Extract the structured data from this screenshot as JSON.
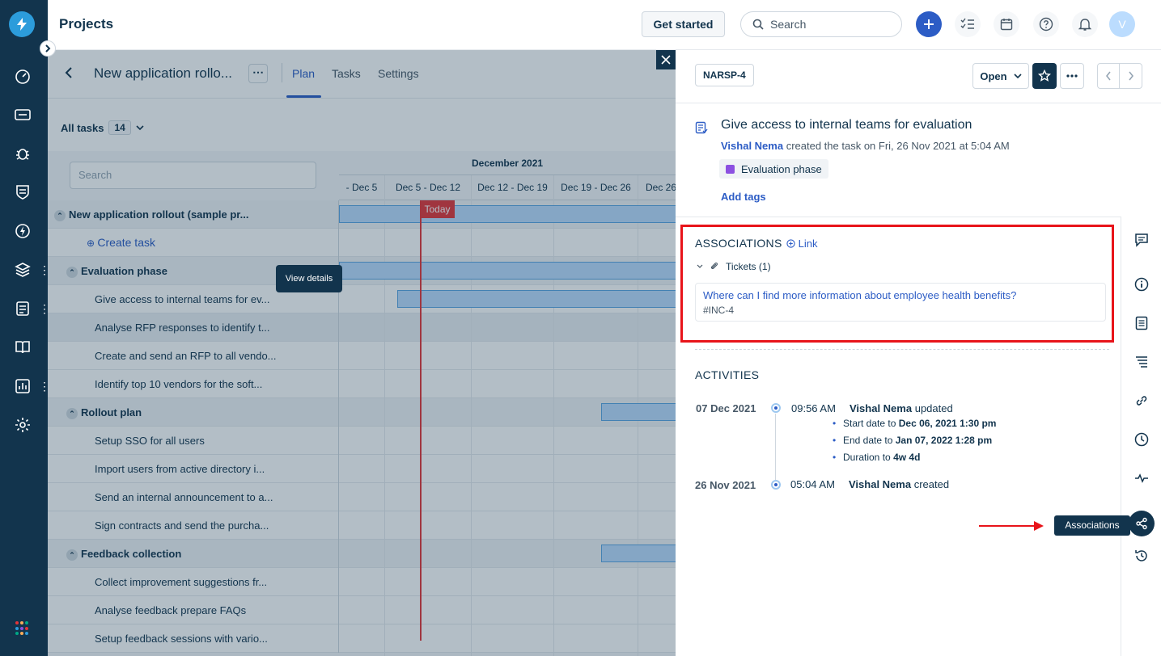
{
  "header": {
    "title": "Projects",
    "get_started": "Get started",
    "search_placeholder": "Search",
    "avatar_initial": "V"
  },
  "project": {
    "title": "New application rollo...",
    "more": "⋯",
    "tabs": [
      "Plan",
      "Tasks",
      "Settings"
    ],
    "all_tasks_label": "All tasks",
    "all_tasks_count": "14",
    "task_search_placeholder": "Search"
  },
  "gantt": {
    "month": "December 2021",
    "weeks": [
      "- Dec 5",
      "Dec 5 - Dec 12",
      "Dec 12 - Dec 19",
      "Dec 19 - Dec 26",
      "Dec 26"
    ],
    "today_label": "Today",
    "view_details": "View details",
    "rows": [
      {
        "label": "New application rollout (sample pr...",
        "type": "group"
      },
      {
        "label": "Create task",
        "type": "create"
      },
      {
        "label": "Evaluation phase",
        "type": "group"
      },
      {
        "label": "Give access to internal teams for ev...",
        "type": "task"
      },
      {
        "label": "Analyse RFP responses to identify t...",
        "type": "task"
      },
      {
        "label": "Create and send an RFP to all vendo...",
        "type": "task"
      },
      {
        "label": "Identify top 10 vendors for the soft...",
        "type": "task"
      },
      {
        "label": "Rollout plan",
        "type": "group"
      },
      {
        "label": "Setup SSO for all users",
        "type": "task"
      },
      {
        "label": "Import users from active directory i...",
        "type": "task"
      },
      {
        "label": "Send an internal announcement to a...",
        "type": "task"
      },
      {
        "label": "Sign contracts and send the purcha...",
        "type": "task"
      },
      {
        "label": "Feedback collection",
        "type": "group"
      },
      {
        "label": "Collect improvement suggestions fr...",
        "type": "task"
      },
      {
        "label": "Analyse feedback prepare FAQs",
        "type": "task"
      },
      {
        "label": "Setup feedback sessions with vario...",
        "type": "task"
      }
    ]
  },
  "panel": {
    "task_id": "NARSP-4",
    "status": "Open",
    "task_title": "Give access to internal teams for evaluation",
    "creator_name": "Vishal Nema",
    "created_text": " created the task on Fri, 26 Nov 2021 at 5:04 AM",
    "phase": "Evaluation phase",
    "add_tags": "Add tags",
    "associations_title": "ASSOCIATIONS",
    "link_label": "Link",
    "tickets_label": "Tickets (1)",
    "ticket_title": "Where can I find more information about employee health benefits?",
    "ticket_id": "#INC-4",
    "activities_title": "ACTIVITIES",
    "activities": [
      {
        "date": "07 Dec 2021",
        "time": "09:56 AM",
        "user": "Vishal Nema",
        "action": "updated",
        "changes": [
          {
            "field": "Start date",
            "to": "to",
            "value": "Dec 06, 2021 1:30 pm"
          },
          {
            "field": "End date",
            "to": "to",
            "value": "Jan 07, 2022 1:28 pm"
          },
          {
            "field": "Duration",
            "to": "to",
            "value": "4w 4d"
          }
        ]
      },
      {
        "date": "26 Nov 2021",
        "time": "05:04 AM",
        "user": "Vishal Nema",
        "action": "created"
      }
    ],
    "tooltip": "Associations"
  },
  "colors": {
    "nav_bg": "#12344d",
    "accent": "#2c5cc5",
    "highlight_red": "#e8141a",
    "today_red": "#e43538"
  }
}
